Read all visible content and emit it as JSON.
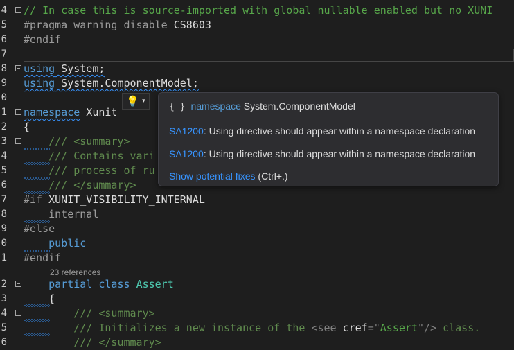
{
  "editor": {
    "lines": [
      {
        "num": "4",
        "segments": [
          {
            "t": "// In case this is source-imported with global nullable enabled but no XUNI",
            "c": "cm"
          }
        ],
        "fold": true
      },
      {
        "num": "5",
        "segments": [
          {
            "t": "#pragma warning disable ",
            "c": "pp"
          },
          {
            "t": "CS8603",
            "c": "id"
          }
        ]
      },
      {
        "num": "6",
        "segments": [
          {
            "t": "#endif",
            "c": "pp"
          }
        ]
      },
      {
        "num": "7",
        "segments": []
      },
      {
        "num": "8",
        "segments": [
          {
            "t": "using",
            "c": "kw squig"
          },
          {
            "t": " System;",
            "c": "id squig"
          }
        ],
        "fold": true
      },
      {
        "num": "9",
        "segments": [
          {
            "t": "using",
            "c": "kw squig"
          },
          {
            "t": " System.ComponentModel;",
            "c": "id squig"
          }
        ]
      },
      {
        "num": "0",
        "segments": []
      },
      {
        "num": "1",
        "segments": [
          {
            "t": "namespace",
            "c": "kw squig"
          },
          {
            "t": " Xunit",
            "c": "id"
          }
        ],
        "fold": true
      },
      {
        "num": "2",
        "segments": [
          {
            "t": "{",
            "c": "id"
          }
        ]
      },
      {
        "num": "3",
        "segments": [
          {
            "t": "    ",
            "c": "id"
          },
          {
            "t": "/// <summary>",
            "c": "doc"
          }
        ],
        "fold": true
      },
      {
        "num": "4",
        "segments": [
          {
            "t": "    ",
            "c": "id"
          },
          {
            "t": "/// Contains vari",
            "c": "doc"
          }
        ]
      },
      {
        "num": "5",
        "segments": [
          {
            "t": "    ",
            "c": "id"
          },
          {
            "t": "/// process of ru",
            "c": "doc"
          }
        ]
      },
      {
        "num": "6",
        "segments": [
          {
            "t": "    ",
            "c": "id"
          },
          {
            "t": "/// </summary>",
            "c": "doc"
          }
        ]
      },
      {
        "num": "7",
        "segments": [
          {
            "t": "#if ",
            "c": "pp"
          },
          {
            "t": "XUNIT_VISIBILITY_INTERNAL",
            "c": "id"
          }
        ]
      },
      {
        "num": "8",
        "segments": [
          {
            "t": "    internal",
            "c": "dim"
          }
        ]
      },
      {
        "num": "9",
        "segments": [
          {
            "t": "#else",
            "c": "pp"
          }
        ]
      },
      {
        "num": "0",
        "segments": [
          {
            "t": "    ",
            "c": "id"
          },
          {
            "t": "public",
            "c": "kw"
          }
        ]
      },
      {
        "num": "1",
        "segments": [
          {
            "t": "#endif",
            "c": "pp"
          }
        ]
      },
      {
        "num": "2",
        "segments": [
          {
            "t": "    ",
            "c": "id"
          },
          {
            "t": "partial",
            "c": "kw"
          },
          {
            "t": " ",
            "c": "id"
          },
          {
            "t": "class",
            "c": "kw"
          },
          {
            "t": " ",
            "c": "id"
          },
          {
            "t": "Assert",
            "c": "ty"
          }
        ],
        "fold": true
      },
      {
        "num": "3",
        "segments": [
          {
            "t": "    {",
            "c": "id"
          }
        ]
      },
      {
        "num": "4",
        "segments": [
          {
            "t": "        ",
            "c": "id"
          },
          {
            "t": "/// <summary>",
            "c": "doc"
          }
        ],
        "fold": true
      },
      {
        "num": "5",
        "segments": [
          {
            "t": "        ",
            "c": "id"
          },
          {
            "t": "/// Initializes a new instance of the ",
            "c": "doc"
          },
          {
            "t": "<see ",
            "c": "xml"
          },
          {
            "t": "cref",
            "c": "id"
          },
          {
            "t": "=\"",
            "c": "xml"
          },
          {
            "t": "Assert",
            "c": "str"
          },
          {
            "t": "\"/>",
            "c": "xml"
          },
          {
            "t": " class.",
            "c": "doc"
          }
        ]
      },
      {
        "num": "6",
        "segments": [
          {
            "t": "        ",
            "c": "id"
          },
          {
            "t": "/// </summary>",
            "c": "doc"
          }
        ]
      }
    ],
    "codelens": "23 references",
    "partial_line_4": "5",
    "fold_first": "4"
  },
  "tooltip": {
    "icon": "{ }",
    "kind": "namespace",
    "symbol": "System.ComponentModel",
    "diag1_code": "SA1200",
    "diag1_text": ": Using directive should appear within a namespace declaration",
    "diag2_code": "SA1200",
    "diag2_text": ": Using directive should appear within a namespace declaration",
    "fix_link": "Show potential fixes",
    "fix_shortcut": " (Ctrl+.)"
  },
  "lightbulb": {
    "icon": "lightbulb-icon",
    "glyph": "💡",
    "chevron": "▾"
  }
}
